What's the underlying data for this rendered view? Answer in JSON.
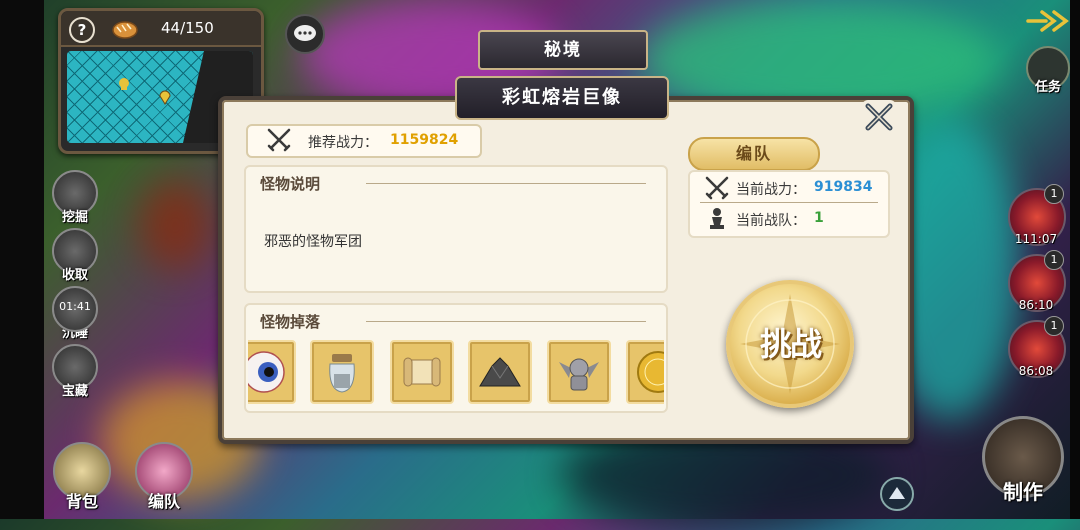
{
  "hud": {
    "stamina": "44/150",
    "help_label": "?"
  },
  "left_menu": [
    {
      "label": "挖掘"
    },
    {
      "label": "收取"
    },
    {
      "label": "沉睡",
      "timer": "01:41"
    },
    {
      "label": "宝藏"
    }
  ],
  "bottom_menu": [
    {
      "label": "背包"
    },
    {
      "label": "编队"
    }
  ],
  "dialog": {
    "category": "秘境",
    "boss_name": "彩虹熔岩巨像",
    "recommended_power_label": "推荐战力：",
    "recommended_power_value": "1159824",
    "monster_desc_title": "怪物说明",
    "monster_desc_text": "邪恶的怪物军团",
    "monster_drops_title": "怪物掉落",
    "drops": [
      {
        "icon": "eyeball-icon"
      },
      {
        "icon": "jar-icon"
      },
      {
        "icon": "scroll-icon"
      },
      {
        "icon": "ore-pile-icon"
      },
      {
        "icon": "gargoyle-icon"
      },
      {
        "icon": "gold-coin-icon"
      }
    ],
    "team_button": "编队",
    "current_power_label": "当前战力：",
    "current_power_value": "919834",
    "current_team_label": "当前战队：",
    "current_team_value": "1",
    "challenge_button": "挑战"
  },
  "right_menu": {
    "task_label": "任务",
    "timers": [
      {
        "time": "111:07",
        "badge": "1"
      },
      {
        "time": "86:10",
        "badge": "1"
      },
      {
        "time": "86:08",
        "badge": "1"
      }
    ],
    "make_label": "制作"
  },
  "colors": {
    "accent_gold": "#e0a000",
    "power_blue": "#2b8fd4",
    "team_green": "#3aa03a"
  }
}
